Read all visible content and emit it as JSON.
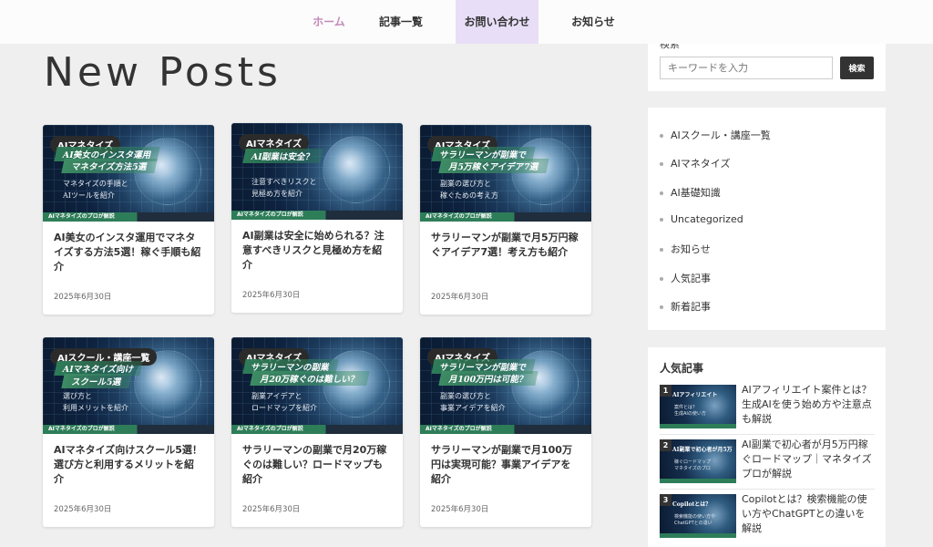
{
  "nav": {
    "items": [
      {
        "label": "ホーム"
      },
      {
        "label": "記事一覧"
      },
      {
        "label": "お問い合わせ"
      },
      {
        "label": "お知らせ"
      }
    ]
  },
  "main": {
    "title": "New Posts",
    "posts": [
      {
        "category": "AIマネタイズ",
        "thumb_headline": "AI美女のインスタ運用",
        "thumb_headline2": "マネタイズ方法5選",
        "thumb_sub": "マネタイズの手順と\nAIツールを紹介",
        "thumb_strip": "AIマネタイズのプロが解説",
        "title": "AI美女のインスタ運用でマネタイズする方法5選！稼ぐ手順も紹介",
        "date": "2025年6月30日"
      },
      {
        "category": "AIマネタイズ",
        "thumb_headline": "AI副業は安全？",
        "thumb_headline2": "",
        "thumb_sub": "注意すべきリスクと\n見極め方を紹介",
        "thumb_strip": "AIマネタイズのプロが解説",
        "title": "AI副業は安全に始められる？注意すべきリスクと見極め方を紹介",
        "date": "2025年6月30日"
      },
      {
        "category": "AIマネタイズ",
        "thumb_headline": "サラリーマンが副業で",
        "thumb_headline2": "月5万稼ぐアイデア7選",
        "thumb_sub": "副業の選び方と\n稼ぐための考え方",
        "thumb_strip": "AIマネタイズのプロが解説",
        "title": "サラリーマンが副業で月5万円稼ぐアイデア7選！考え方も紹介",
        "date": "2025年6月30日"
      },
      {
        "category": "AIスクール・講座一覧",
        "thumb_headline": "AIマネタイズ向け",
        "thumb_headline2": "スクール5選",
        "thumb_sub": "選び方と\n利用メリットを紹介",
        "thumb_strip": "AIマネタイズのプロが解説",
        "title": "AIマネタイズ向けスクール5選！選び方と利用するメリットを紹介",
        "date": "2025年6月30日"
      },
      {
        "category": "AIマネタイズ",
        "thumb_headline": "サラリーマンの副業",
        "thumb_headline2": "月20万稼ぐのは難しい？",
        "thumb_sub": "副業アイデアと\nロードマップを紹介",
        "thumb_strip": "AIマネタイズのプロが解説",
        "title": "サラリーマンの副業で月20万稼ぐのは難しい？ロードマップも紹介",
        "date": "2025年6月30日"
      },
      {
        "category": "AIマネタイズ",
        "thumb_headline": "サラリーマンが副業で",
        "thumb_headline2": "月100万円は可能？",
        "thumb_sub": "副業の選び方と\n事業アイデアを紹介",
        "thumb_strip": "AIマネタイズのプロが解説",
        "title": "サラリーマンが副業で月100万円は実現可能？事業アイデアを紹介",
        "date": "2025年6月30日"
      }
    ]
  },
  "sidebar": {
    "search_label": "検索",
    "search_placeholder": "キーワードを入力",
    "search_button": "検索",
    "categories": [
      {
        "label": "AIスクール・講座一覧"
      },
      {
        "label": "AIマネタイズ"
      },
      {
        "label": "AI基礎知識"
      },
      {
        "label": "Uncategorized"
      },
      {
        "label": "お知らせ"
      },
      {
        "label": "人気記事"
      },
      {
        "label": "新着記事"
      }
    ],
    "popular_heading": "人気記事",
    "popular": [
      {
        "rank": "1",
        "thumb_title": "AIアフィリエイト",
        "thumb_sub": "案件とは？\n生成AIの使い方",
        "title": "AIアフィリエイト案件とは？生成AIを使う始め方や注意点も解説"
      },
      {
        "rank": "2",
        "thumb_title": "AI副業で初心者が月5万",
        "thumb_sub": "稼ぐロードマップ\nマネタイズのプロ",
        "title": "AI副業で初心者が月5万円稼ぐロードマップ｜マネタイズプロが解説"
      },
      {
        "rank": "3",
        "thumb_title": "Copilotとは？",
        "thumb_sub": "検索機能の使い方や\nChatGPTとの違い",
        "title": "Copilotとは？検索機能の使い方やChatGPTとの違いを解説"
      }
    ]
  }
}
